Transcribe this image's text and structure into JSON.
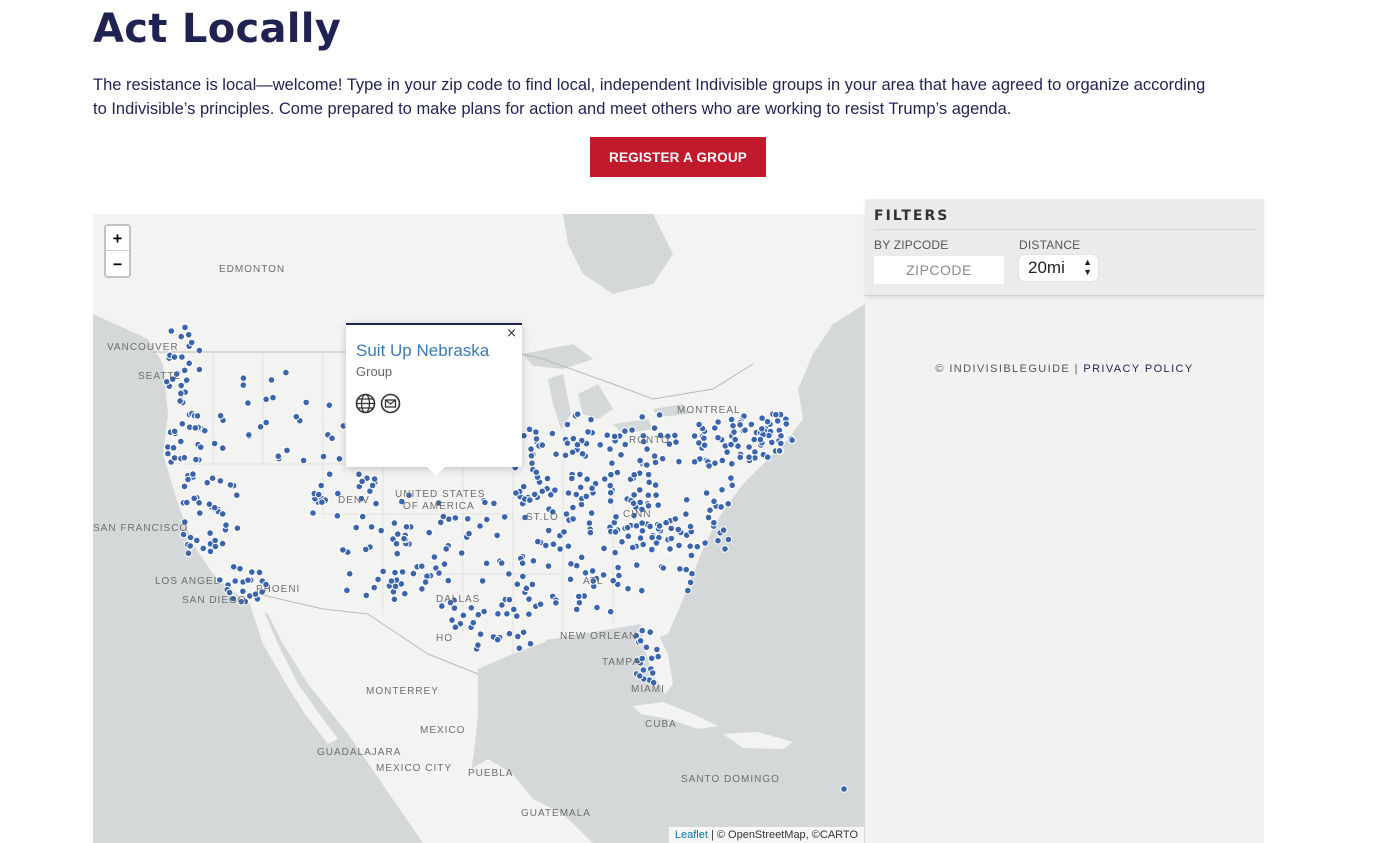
{
  "page": {
    "title": "Act Locally",
    "intro": "The resistance is local—welcome! Type in your zip code to find local, independent Indivisible groups in your area that have agreed to organize according to Indivisible’s principles. Come prepared to make plans for action and meet others who are working to resist Trump’s agenda.",
    "register_label": "REGISTER A GROUP"
  },
  "map": {
    "zoom_in": "+",
    "zoom_out": "−",
    "marker_color": "#3a64ad",
    "cities": {
      "edmonton": "EDMONTON",
      "vancouver": "VANCOUVER",
      "seattle": "SEATTL",
      "montreal": "MONTREAL",
      "toronto": "RONTO",
      "denver": "DENV",
      "usa": "UNITED STATES",
      "usa2": "OF AMERICA",
      "stlouis": "ST.LO",
      "cincinnati": "CINN",
      "sanfrancisco": "SAN FRANCISCO",
      "losangeles": "LOS ANGEL",
      "phoenix": "PHOENI",
      "sandiego": "SAN DIEGO",
      "dallas": "DALLAS",
      "houston": "HO",
      "neworleans": "NEW ORLEAN",
      "atlanta": "ATL",
      "tampa": "TAMPA",
      "miami": "MIAMI",
      "monterrey": "MONTERREY",
      "mexico": "MEXICO",
      "cuba": "CUBA",
      "guadalajara": "GUADALAJARA",
      "mexicocity": "MEXICO CITY",
      "puebla": "PUEBLA",
      "santodomingo": "SANTO DOMINGO",
      "guatemala": "GUATEMALA"
    },
    "popup": {
      "title": "Suit Up Nebraska",
      "type": "Group",
      "close": "×"
    },
    "attribution": {
      "leaflet": "Leaflet",
      "rest": " | © OpenStreetMap, ©CARTO"
    }
  },
  "filters": {
    "title": "FILTERS",
    "zip_label": "BY ZIPCODE",
    "zip_placeholder": "ZIPCODE",
    "distance_label": "DISTANCE",
    "distance_value": "20mi",
    "footer_copy": "© INDIVISIBLEGUIDE | ",
    "privacy_label": "PRIVACY POLICY"
  }
}
